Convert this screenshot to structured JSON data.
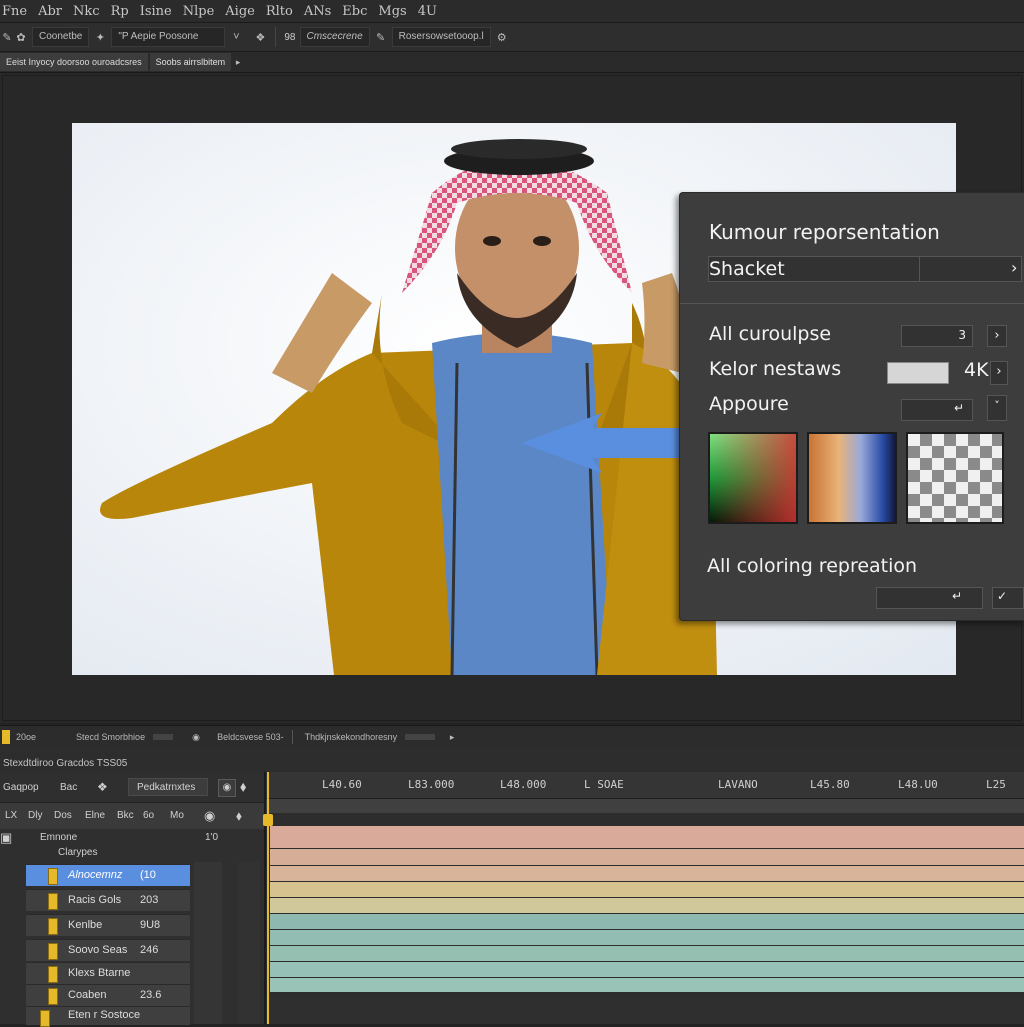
{
  "menu": [
    "Fne",
    "Abr",
    "Nkc",
    "Rp",
    "Isine",
    "Nlpe",
    "Aige",
    "Rlto",
    "ANs",
    "Ebc",
    "Mgs",
    "4U"
  ],
  "optionsbar": {
    "field1": "Coonetbe",
    "field2": "\"P Aepie Poosone",
    "num_label": "98",
    "field3": "Cmscecrene",
    "field4": "Rosersowsetooop.l"
  },
  "docrow": {
    "tab": "Eeist Inyocy doorsoo ouroadcsres",
    "subtab": "Soobs airrslbitem"
  },
  "panel": {
    "title": "Kumour reporsentation",
    "dropdown_value": "Shacket",
    "row1_label": "All curoulpse",
    "row1_value": "3",
    "row2_label": "Kelor nestaws",
    "row2_value": "4K",
    "row3_label": "Appoure",
    "row3_value": "",
    "footer_label": "All coloring repreation",
    "check_glyph": "✓"
  },
  "status": {
    "zoom": "20oe",
    "item2": "Stecd Smorbhioe",
    "item3": "Beldcsvese 503-",
    "item4": "Thdkjnskekondhoresny"
  },
  "timeline": {
    "title": "Stexdtdiroo Gracdos TSS05",
    "comp_label": "Gaqpop",
    "comp_value": "Bac",
    "tab_label": "Pedkatrnxtes",
    "header_cols": [
      "Dly",
      "Dos",
      "Elne",
      "Bkc",
      "6o",
      "Mo"
    ],
    "section1": "Emnone",
    "section1_val": "1'0",
    "section2": "Clarypes",
    "timecodes": [
      "L40.60",
      "L83.000",
      "L48.000",
      "L SOAE",
      "LAVANO",
      "L45.80",
      "L48.U0",
      "L25"
    ],
    "layers": [
      {
        "name": "Alnocemnz",
        "value": "(10"
      },
      {
        "name": "Racis Gols",
        "value": "203"
      },
      {
        "name": "Kenlbe",
        "value": "9U8"
      },
      {
        "name": "Soovo Seas",
        "value": "246"
      },
      {
        "name": "Klexs Btarne",
        "value": ""
      },
      {
        "name": "Coaben",
        "value": "23.6"
      },
      {
        "name": "Eten r Sostoce",
        "value": ""
      }
    ]
  },
  "colors": {
    "accent_blue": "#5a8fe0",
    "layer_chip": "#e6b92b",
    "track_pink": "#d9a999",
    "track_yellow": "#d6c28f",
    "track_teal": "#8db9b0"
  }
}
